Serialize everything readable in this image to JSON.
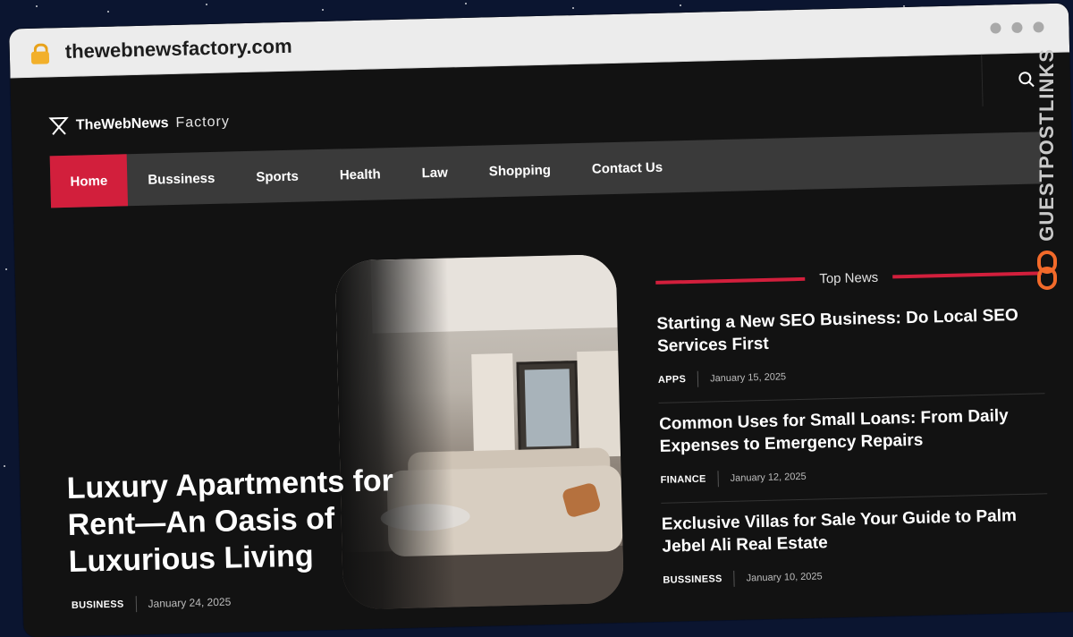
{
  "browser": {
    "url": "thewebnewsfactory.com"
  },
  "site": {
    "logo_bold": "TheWebNews",
    "logo_light": "Factory"
  },
  "nav": {
    "items": [
      "Home",
      "Bussiness",
      "Sports",
      "Health",
      "Law",
      "Shopping",
      "Contact Us"
    ],
    "active": "Home"
  },
  "hero": {
    "title": "Luxury Apartments for Rent—An Oasis of Luxurious Living",
    "category": "BUSINESS",
    "date": "January 24, 2025"
  },
  "top_news": {
    "heading": "Top News",
    "items": [
      {
        "title": "Starting a New SEO Business: Do Local SEO Services First",
        "category": "APPS",
        "date": "January 15, 2025"
      },
      {
        "title": "Common Uses for Small Loans: From Daily Expenses to Emergency Repairs",
        "category": "FINANCE",
        "date": "January 12, 2025"
      },
      {
        "title": "Exclusive Villas for Sale Your Guide to Palm Jebel Ali Real Estate",
        "category": "BUSSINESS",
        "date": "January 10, 2025"
      }
    ]
  },
  "watermark": {
    "text": "GUESTPOSTLINKS"
  },
  "colors": {
    "accent": "#d21f3c",
    "nav_bg": "#3a3a3a",
    "page_bg": "#121212"
  }
}
